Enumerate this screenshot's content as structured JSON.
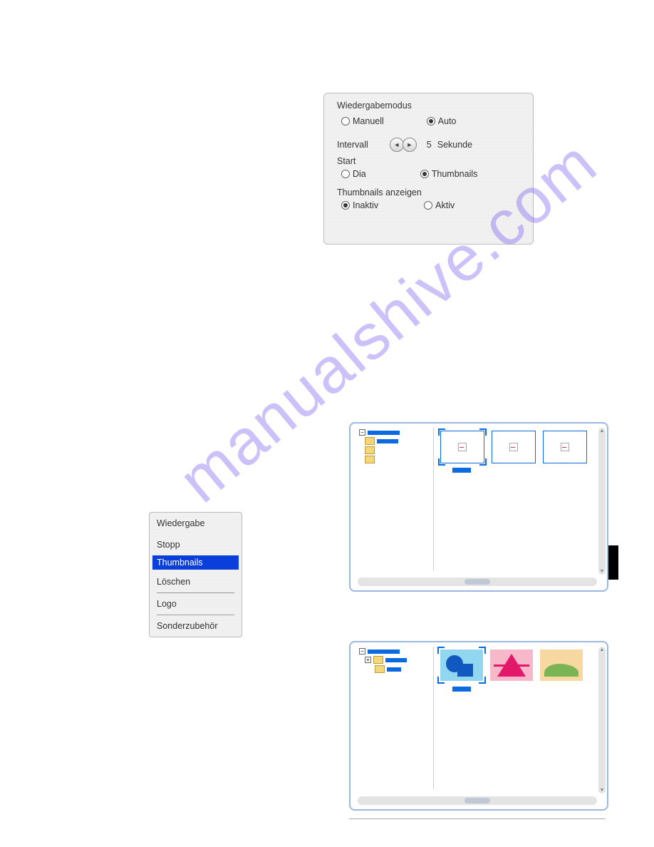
{
  "watermark": "manualshive.com",
  "settings_panel": {
    "title": "Wiedergabemodus",
    "mode": {
      "manual_label": "Manuell",
      "auto_label": "Auto",
      "manual_checked": false,
      "auto_checked": true
    },
    "interval": {
      "label": "Intervall",
      "value": "5",
      "unit": "Sekunde"
    },
    "start": {
      "label": "Start",
      "dia_label": "Dia",
      "thumbnails_label": "Thumbnails",
      "dia_checked": false,
      "thumbnails_checked": true
    },
    "thumbs_show": {
      "label": "Thumbnails anzeigen",
      "inactive_label": "Inaktiv",
      "active_label": "Aktiv",
      "inactive_checked": true,
      "active_checked": false
    }
  },
  "menu": {
    "items": [
      {
        "label": "Wiedergabe",
        "selected": false
      },
      {
        "label": "Stopp",
        "selected": false
      },
      {
        "label": "Thumbnails",
        "selected": true
      },
      {
        "label": "Löschen",
        "selected": false
      },
      {
        "label": "Logo",
        "selected": false
      },
      {
        "label": "Sonderzubehör",
        "selected": false
      }
    ]
  },
  "tree": {
    "expand_minus": "−",
    "expand_plus": "+"
  }
}
